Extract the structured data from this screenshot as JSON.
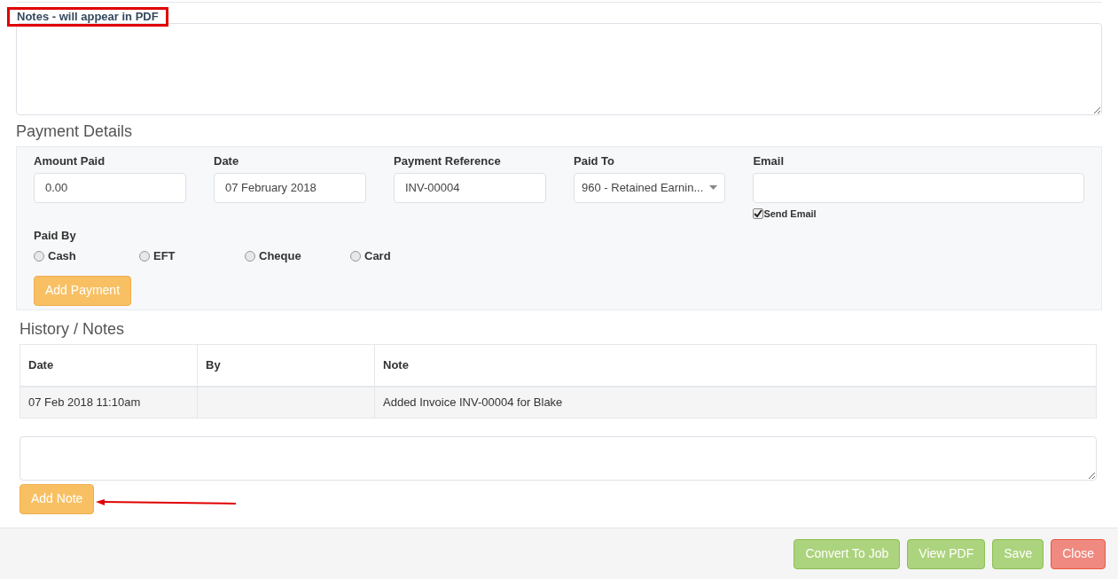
{
  "notes": {
    "label": "Notes - will appear in PDF"
  },
  "payment_details": {
    "title": "Payment Details",
    "fields": [
      {
        "kind": "input",
        "label": "Amount Paid",
        "value": "0.00"
      },
      {
        "kind": "input",
        "label": "Date",
        "value": "07 February 2018"
      },
      {
        "kind": "input",
        "label": "Payment Reference",
        "value": "INV-00004"
      },
      {
        "kind": "select",
        "label": "Paid To",
        "value": "960 - Retained Earnin..."
      },
      {
        "kind": "email",
        "label": "Email",
        "checkbox": {
          "label": "Send Email",
          "checked": true
        }
      }
    ],
    "paid_by": {
      "label": "Paid By",
      "options": [
        {
          "label": "Cash",
          "selected": false
        },
        {
          "label": "EFT",
          "selected": false
        },
        {
          "label": "Cheque",
          "selected": false
        },
        {
          "label": "Card",
          "selected": false
        }
      ]
    },
    "button": "Add Payment"
  },
  "history": {
    "title": "History / Notes",
    "columns": [
      "Date",
      "By",
      "Note"
    ],
    "rows": [
      [
        "07 Feb 2018 11:10am",
        "",
        "Added Invoice INV-00004 for Blake"
      ]
    ],
    "button": "Add Note"
  },
  "footer": {
    "buttons": [
      {
        "label": "Convert To Job",
        "kind": "success"
      },
      {
        "label": "View PDF",
        "kind": "success"
      },
      {
        "label": "Save",
        "kind": "success"
      },
      {
        "label": "Close",
        "kind": "danger"
      }
    ]
  }
}
